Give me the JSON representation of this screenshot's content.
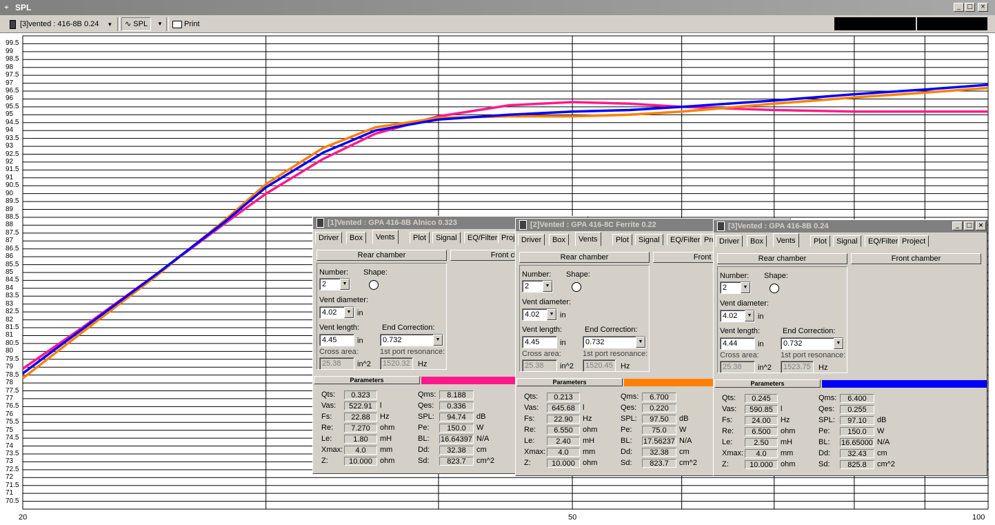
{
  "window": {
    "title": "SPL",
    "minimize": "_",
    "maximize": "□",
    "close": "×"
  },
  "toolbar": {
    "project_select": "[3]vented : 416-8B  0.24",
    "mode": "SPL",
    "print": "Print"
  },
  "chart_data": {
    "type": "line",
    "x_scale": "log",
    "xlim": [
      20,
      100
    ],
    "ylim": [
      70,
      100
    ],
    "x_ticks": [
      "20",
      "50",
      "100"
    ],
    "y_ticks": [
      "99.5",
      "99",
      "98.5",
      "98",
      "97.5",
      "97",
      "96.5",
      "96",
      "95.5",
      "95",
      "94.5",
      "94",
      "93.5",
      "93",
      "92.5",
      "92",
      "91.5",
      "91",
      "90.5",
      "90",
      "89.5",
      "89",
      "88.5",
      "88",
      "87.5",
      "87",
      "86.5",
      "86",
      "85.5",
      "85",
      "84.5",
      "84",
      "83.5",
      "83",
      "82.5",
      "82",
      "81.5",
      "81",
      "80.5",
      "80",
      "79.5",
      "79",
      "78.5",
      "78",
      "77.5",
      "77",
      "76.5",
      "76",
      "75.5",
      "75",
      "74.5",
      "74",
      "73.5",
      "73",
      "72.5",
      "72",
      "71.5",
      "71",
      "70.5"
    ],
    "grid": true,
    "series": [
      {
        "color": "#ff1a8c",
        "x": [
          20,
          22,
          25,
          28,
          30,
          33,
          36,
          40,
          45,
          50,
          55,
          60,
          70,
          80,
          90,
          100
        ],
        "y": [
          78.9,
          81.4,
          84.9,
          88.1,
          90.0,
          92.2,
          93.8,
          94.9,
          95.6,
          95.8,
          95.7,
          95.5,
          95.3,
          95.2,
          95.2,
          95.2
        ]
      },
      {
        "color": "#ff8000",
        "x": [
          20,
          22,
          25,
          28,
          30,
          33,
          36,
          40,
          45,
          50,
          55,
          60,
          70,
          80,
          90,
          100
        ],
        "y": [
          78.3,
          81.1,
          84.8,
          88.3,
          90.6,
          92.9,
          94.2,
          94.8,
          94.9,
          94.9,
          95.0,
          95.2,
          95.7,
          96.1,
          96.4,
          96.7
        ]
      },
      {
        "color": "#0000ff",
        "x": [
          20,
          22,
          25,
          28,
          30,
          33,
          36,
          40,
          45,
          50,
          55,
          60,
          70,
          80,
          90,
          100
        ],
        "y": [
          78.6,
          81.3,
          84.9,
          88.2,
          90.4,
          92.6,
          94.0,
          94.7,
          95.0,
          95.2,
          95.3,
          95.5,
          95.9,
          96.3,
          96.6,
          96.9
        ]
      }
    ]
  },
  "tabs": [
    "Driver",
    "Box",
    "Vents",
    "Plot",
    "Signal",
    "EQ/Filter",
    "Project"
  ],
  "labels": {
    "rear": "Rear chamber",
    "front": "Front chamber",
    "number": "Number:",
    "shape": "Shape:",
    "vent_diam": "Vent diameter:",
    "vent_len": "Vent length:",
    "end_corr": "End Correction:",
    "cross": "Cross area:",
    "res": "1st port resonance:",
    "in": "in",
    "in2": "in^2",
    "hz": "Hz",
    "params": "Parameters"
  },
  "param_labels": {
    "qts": "Qts:",
    "vas": "Vas:",
    "fs": "Fs:",
    "re": "Re:",
    "le": "Le:",
    "xmax": "Xmax:",
    "z": "Z:",
    "qms": "Qms:",
    "qes": "Qes:",
    "spl": "SPL:",
    "pe": "Pe:",
    "bl": "BL:",
    "dd": "Dd:",
    "sd": "Sd:"
  },
  "units": {
    "vas": "l",
    "fs": "Hz",
    "re": "ohm",
    "le": "mH",
    "xmax": "mm",
    "z": "ohm",
    "spl": "dB",
    "pe": "W",
    "bl": "N/A",
    "dd": "cm",
    "sd": "cm^2"
  },
  "panels": [
    {
      "title": "[1]Vented : GPA 416-8B Alnico 0.323",
      "color": "#ff1a8c",
      "number": "2",
      "diam": "4.02",
      "len": "4.45",
      "end": "0.732",
      "cross": "25.38",
      "res": "1520.32",
      "p": {
        "qts": "0.323",
        "vas": "522.91",
        "fs": "22.88",
        "re": "7.270",
        "le": "1.80",
        "xmax": "4.0",
        "z": "10.000",
        "qms": "8.188",
        "qes": "0.336",
        "spl": "94.74",
        "pe": "150.0",
        "bl": "16.64397",
        "dd": "32.38",
        "sd": "823.7"
      }
    },
    {
      "title": "[2]Vented : GPA 416-8C Ferrite 0.22",
      "color": "#ff8000",
      "number": "2",
      "diam": "4.02",
      "len": "4.45",
      "end": "0.732",
      "cross": "25.38",
      "res": "1520.45",
      "p": {
        "qts": "0.213",
        "vas": "645.68",
        "fs": "22.90",
        "re": "6.550",
        "le": "2.40",
        "xmax": "4.0",
        "z": "10.000",
        "qms": "6.700",
        "qes": "0.220",
        "spl": "97.50",
        "pe": "75.0",
        "bl": "17.56237",
        "dd": "32.38",
        "sd": "823.7"
      }
    },
    {
      "title": "[3]Vented : GPA 416-8B  0.24",
      "color": "#0000ff",
      "number": "2",
      "diam": "4.02",
      "len": "4.44",
      "end": "0.732",
      "cross": "25.38",
      "res": "1523.75",
      "p": {
        "qts": "0.245",
        "vas": "590.85",
        "fs": "24.00",
        "re": "6.500",
        "le": "2.50",
        "xmax": "4.0",
        "z": "10.000",
        "qms": "6.400",
        "qes": "0.255",
        "spl": "97.10",
        "pe": "150.0",
        "bl": "16.65000",
        "dd": "32.43",
        "sd": "825.8"
      }
    }
  ]
}
